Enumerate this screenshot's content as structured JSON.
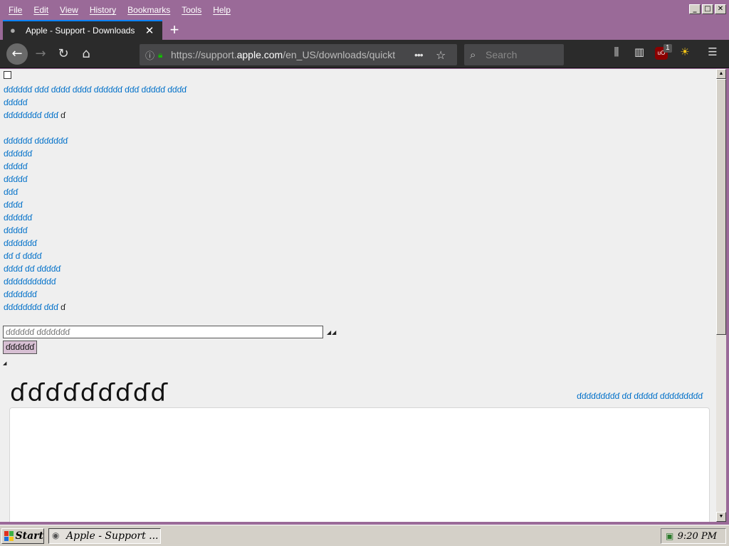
{
  "menubar": {
    "items": [
      "File",
      "Edit",
      "View",
      "History",
      "Bookmarks",
      "Tools",
      "Help"
    ]
  },
  "window_controls": {
    "minimize": "_",
    "maximize": "□",
    "close": "✕"
  },
  "tab": {
    "title": "Apple - Support - Downloads",
    "close": "✕",
    "new_tab": "+"
  },
  "toolbar": {
    "url_prefix": "https://support.",
    "url_domain": "apple.com",
    "url_path": "/en_US/downloads/quickt",
    "url_more": "•••",
    "search_placeholder": "Search",
    "ublock_count": "1"
  },
  "content": {
    "links": [
      [
        {
          "text": "ɗɗɗɗɗɗ ɗɗɗ ɗɗɗɗ ɗɗɗɗ ɗɗɗɗɗɗ ɗɗɗ ɗɗɗɗɗ ɗɗɗɗ"
        }
      ],
      [
        {
          "text": "ɗɗɗɗɗ"
        }
      ],
      [
        {
          "text": "ɗɗɗɗɗɗɗɗ ɗɗɗ "
        },
        {
          "text": "ɗ",
          "plain": true
        }
      ],
      [],
      [
        {
          "text": "ɗɗɗɗɗɗ ɗɗɗɗɗɗɗ"
        }
      ],
      [
        {
          "text": "ɗɗɗɗɗɗ"
        }
      ],
      [
        {
          "text": "ɗɗɗɗɗ"
        }
      ],
      [
        {
          "text": "ɗɗɗɗɗ"
        }
      ],
      [
        {
          "text": "ɗɗɗ"
        }
      ],
      [
        {
          "text": "ɗɗɗɗ"
        }
      ],
      [
        {
          "text": "ɗɗɗɗɗɗ"
        }
      ],
      [
        {
          "text": "ɗɗɗɗɗ"
        }
      ],
      [
        {
          "text": "ɗɗɗɗɗɗɗ"
        }
      ],
      [
        {
          "text": "ɗɗ ɗ ɗɗɗɗ"
        }
      ],
      [
        {
          "text": "ɗɗɗɗ ɗɗ ɗɗɗɗɗ"
        }
      ],
      [
        {
          "text": "ɗɗɗɗɗɗɗɗɗɗɗ"
        }
      ],
      [
        {
          "text": "ɗɗɗɗɗɗɗ"
        }
      ],
      [
        {
          "text": "ɗɗɗɗɗɗɗɗ ɗɗɗ "
        },
        {
          "text": "ɗ",
          "plain": true
        }
      ]
    ],
    "search_placeholder": "ɗɗɗɗɗɗ ɗɗɗɗɗɗɗ",
    "input_marks": "◢◢",
    "submit_label": "ɗɗɗɗɗɗ",
    "small_mark": "◢",
    "heading": "ɗɗɗɗɗɗɗɗɗ",
    "heading_link": "ɗɗɗɗɗɗɗɗɗ ɗɗ ɗɗɗɗɗ ɗɗɗɗɗɗɗɗɗ"
  },
  "taskbar": {
    "start_label": "Start",
    "task_label": "Apple - Support ...",
    "clock": "9:20 PM"
  },
  "colors": {
    "window_frame": "#9a6a98",
    "toolbar": "#2b2b2b",
    "link": "#0070c9",
    "content_bg": "#efefef"
  }
}
